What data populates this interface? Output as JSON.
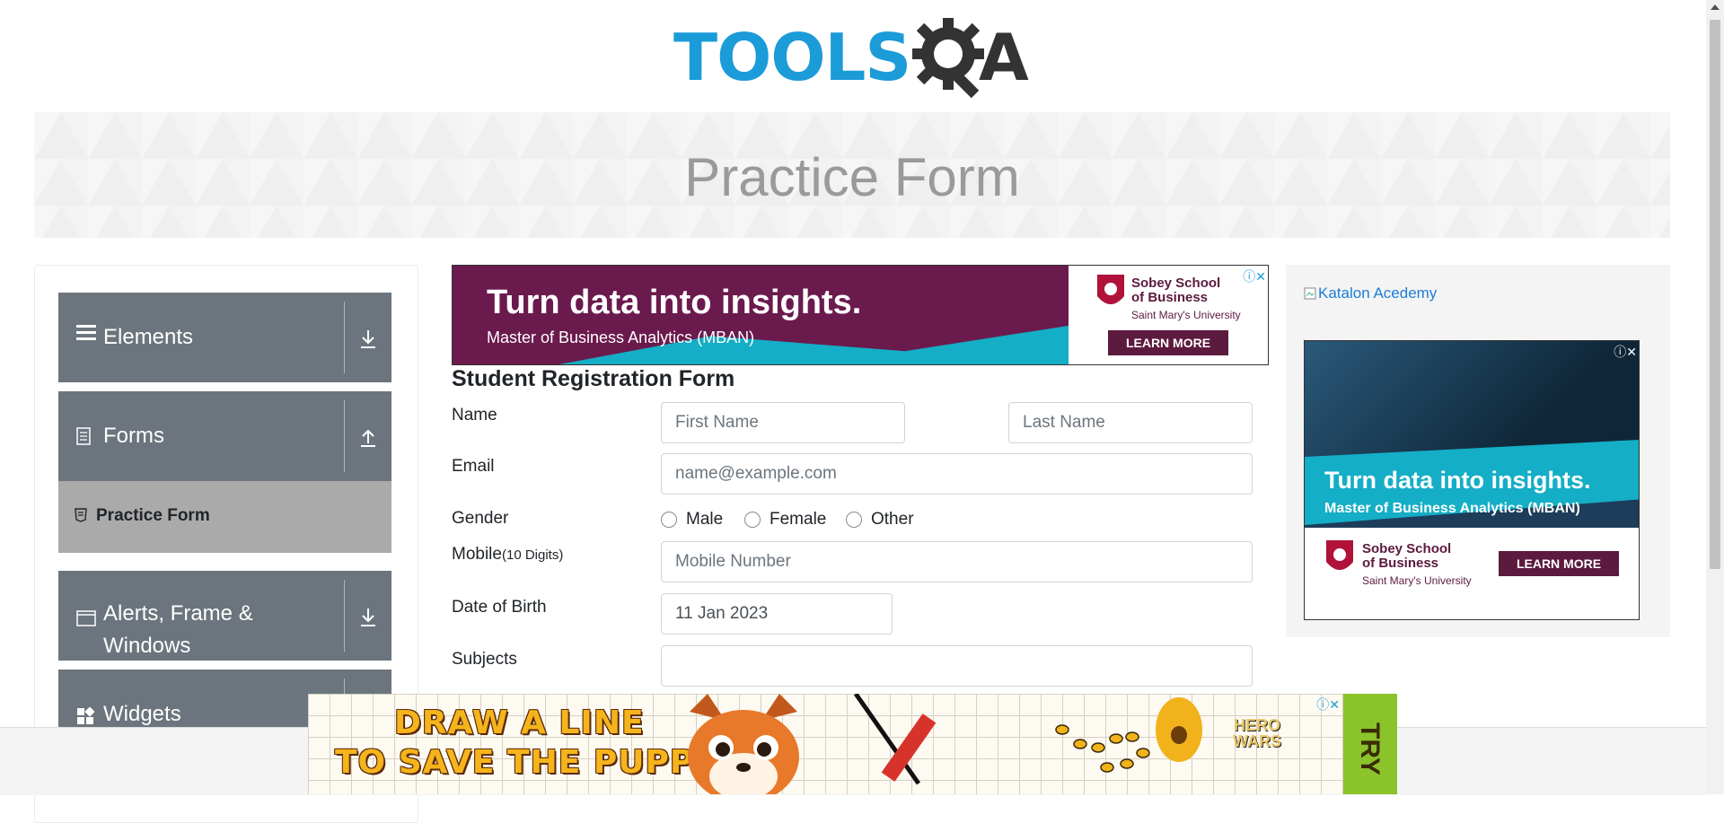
{
  "header": {
    "logo_text_left": "TOOLS",
    "logo_text_right": "A"
  },
  "banner": {
    "title": "Practice Form"
  },
  "sidebar": {
    "groups": [
      {
        "label": "Elements",
        "icon": "menu-icon",
        "toggle": "download-icon"
      },
      {
        "label": "Forms",
        "icon": "document-icon",
        "toggle": "upload-icon"
      },
      {
        "label": "Alerts, Frame & Windows",
        "icon": "window-icon",
        "toggle": "download-icon"
      },
      {
        "label": "Widgets",
        "icon": "widgets-icon",
        "toggle": "download-icon"
      }
    ],
    "active_item": {
      "label": "Practice Form",
      "icon": "html-icon"
    }
  },
  "ad_top": {
    "headline": "Turn data into insights.",
    "subline": "Master of Business Analytics (MBAN)",
    "brand_line1": "Sobey School",
    "brand_line2": "of Business",
    "brand_sub": "Saint Mary's University",
    "button": "LEARN MORE"
  },
  "form": {
    "title": "Student Registration Form",
    "name_label": "Name",
    "first_name_placeholder": "First Name",
    "last_name_placeholder": "Last Name",
    "email_label": "Email",
    "email_placeholder": "name@example.com",
    "gender_label": "Gender",
    "gender_options": [
      "Male",
      "Female",
      "Other"
    ],
    "mobile_label": "Mobile",
    "mobile_hint": "(10 Digits)",
    "mobile_placeholder": "Mobile Number",
    "dob_label": "Date of Birth",
    "dob_value": "11 Jan 2023",
    "subjects_label": "Subjects"
  },
  "right_column": {
    "link_text": "Katalon Acedemy",
    "ad": {
      "headline": "Turn data into insights.",
      "subline": "Master of Business Analytics (MBAN)",
      "brand_line1": "Sobey School",
      "brand_line2": "of Business",
      "brand_sub": "Saint Mary's University",
      "button": "LEARN MORE"
    }
  },
  "ad_bottom": {
    "line1": "DRAW A LINE",
    "line2": "TO SAVE THE PUPPY",
    "brand_line1": "HERO",
    "brand_line2": "WARS",
    "cta": "TRY"
  },
  "colors": {
    "accent_blue": "#1b9bd8",
    "sidebar_group": "#6c757d",
    "sidebar_active": "#aaaaaa",
    "ad_teal": "#14aec6",
    "ad_purple": "#6b1a4d"
  }
}
